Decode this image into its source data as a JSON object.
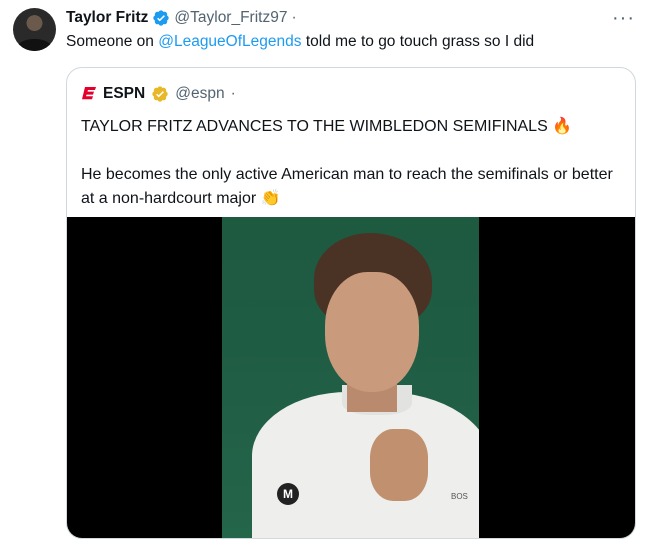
{
  "tweet": {
    "author_name": "Taylor Fritz",
    "author_handle": "@Taylor_Fritz97",
    "separator": "·",
    "more_icon": "···",
    "text_before": "Someone on ",
    "mention": "@LeagueOfLegends",
    "text_after": " told me to go touch grass so I did"
  },
  "quote": {
    "author_name": "ESPN",
    "author_handle": "@espn",
    "separator": "·",
    "line1": "TAYLOR FRITZ ADVANCES TO THE WIMBLEDON SEMIFINALS 🔥",
    "line2": "He becomes the only active American man to reach the semifinals or better at a non-hardcourt major 👏",
    "image_brand_text": "BOS"
  },
  "colors": {
    "accent": "#1d9bf0",
    "espn_red": "#e4002b",
    "gold_badge": "#e8b829",
    "muted": "#536471"
  }
}
